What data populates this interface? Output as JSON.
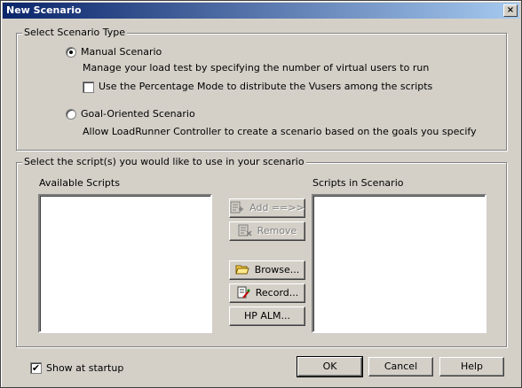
{
  "window": {
    "title": "New Scenario",
    "close_glyph": "×"
  },
  "scenario_type": {
    "legend": "Select Scenario Type",
    "manual": {
      "label": "Manual Scenario",
      "selected": true,
      "description": "Manage your load test by specifying the number of virtual users to run"
    },
    "percentage_mode": {
      "label": "Use the Percentage Mode to distribute the Vusers among the scripts",
      "checked": false
    },
    "goal": {
      "label": "Goal-Oriented Scenario",
      "selected": false,
      "description": "Allow LoadRunner Controller to create a scenario based on the goals you specify"
    }
  },
  "scripts": {
    "legend": "Select the script(s) you would like to use in your scenario",
    "available_label": "Available Scripts",
    "in_scenario_label": "Scripts in Scenario",
    "available_items": [],
    "scenario_items": []
  },
  "buttons": {
    "add": {
      "label": "Add ==>>",
      "icon": "add-script-icon",
      "enabled": false
    },
    "remove": {
      "label": "Remove",
      "icon": "remove-script-icon",
      "enabled": false
    },
    "browse": {
      "label": "Browse...",
      "icon": "folder-open-icon",
      "enabled": true
    },
    "record": {
      "label": "Record...",
      "icon": "record-icon",
      "enabled": true
    },
    "hpalm": {
      "label": "HP ALM...",
      "enabled": true
    },
    "ok": "OK",
    "cancel": "Cancel",
    "help": "Help"
  },
  "show_at_startup": {
    "label": "Show at startup",
    "checked": true,
    "check_glyph": "✔"
  }
}
